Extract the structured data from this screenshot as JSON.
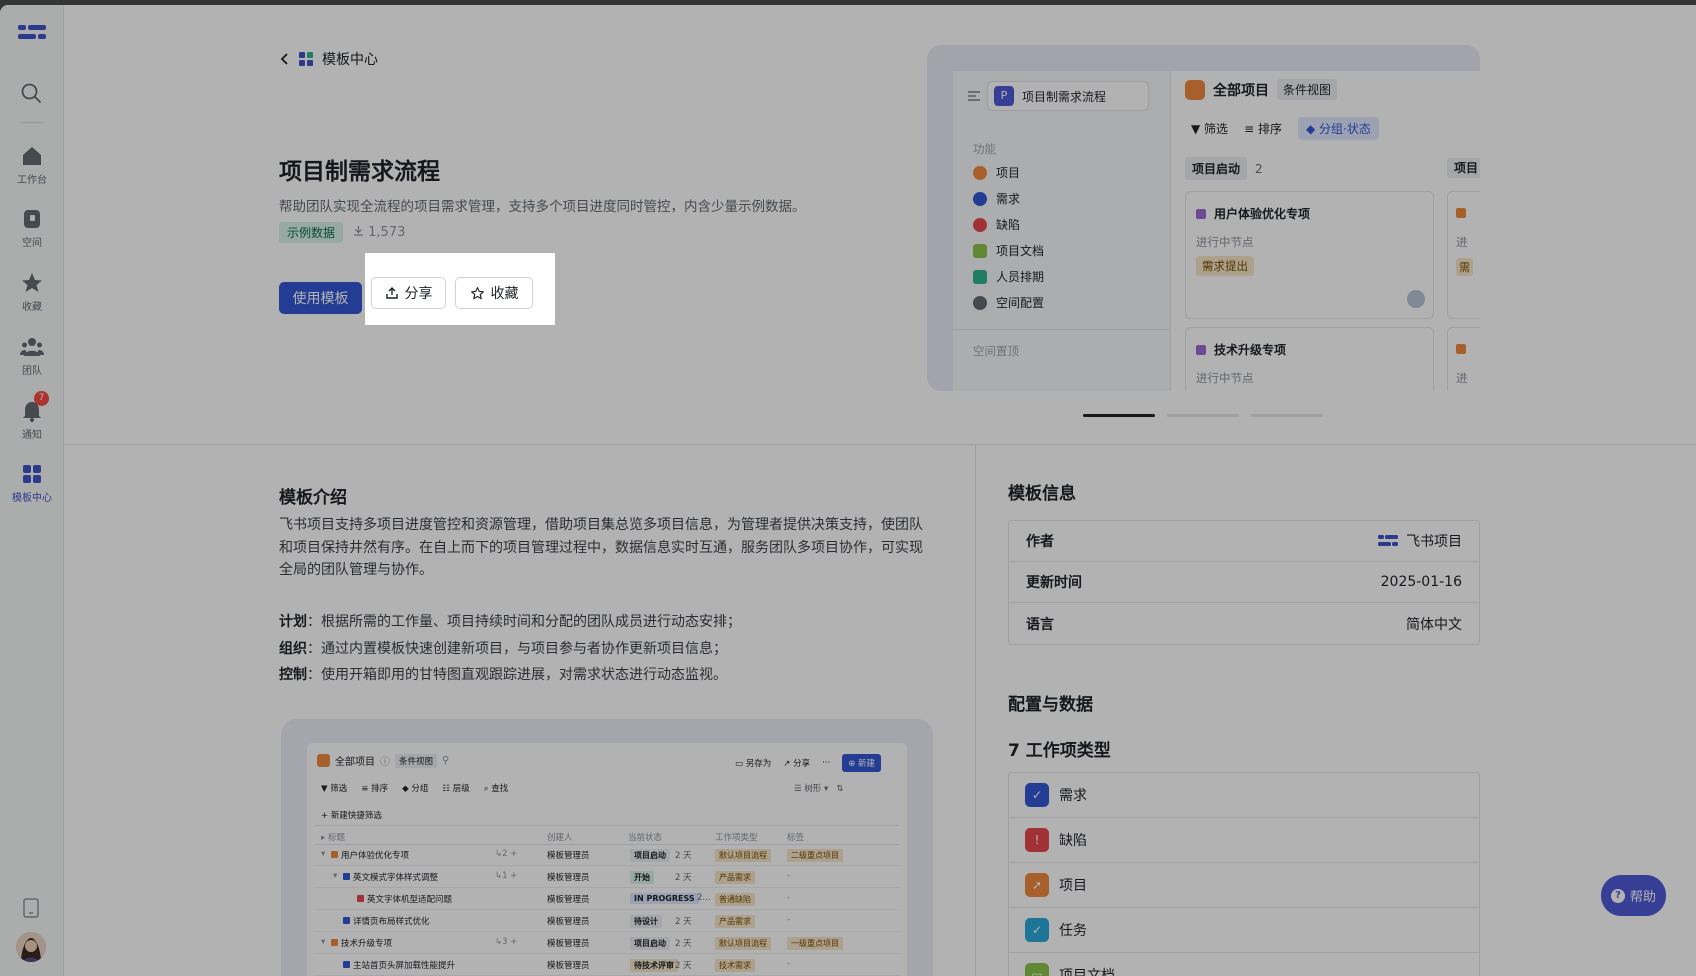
{
  "header": {
    "back_label": "模板中心"
  },
  "template": {
    "title": "项目制需求流程",
    "subtitle": "帮助团队实现全流程的项目需求管理，支持多个项目进度同时管控，内含少量示例数据。",
    "tag": "示例数据",
    "downloads": "1,573",
    "use_button": "使用模板",
    "share_button": "分享",
    "favorite_button": "收藏"
  },
  "sidebar": {
    "items": [
      {
        "label": "工作台",
        "icon": "home-icon"
      },
      {
        "label": "空间",
        "icon": "space-icon"
      },
      {
        "label": "收藏",
        "icon": "star-icon"
      },
      {
        "label": "团队",
        "icon": "team-icon"
      },
      {
        "label": "通知",
        "icon": "bell-icon",
        "badge": "7"
      },
      {
        "label": "模板中心",
        "icon": "template-icon",
        "active": true
      }
    ]
  },
  "preview": {
    "project_name": "项目制需求流程",
    "project_initial": "P",
    "section_label": "功能",
    "nav": [
      {
        "label": "项目",
        "color": "#f08a3e"
      },
      {
        "label": "需求",
        "color": "#3358d4"
      },
      {
        "label": "缺陷",
        "color": "#e5484d"
      },
      {
        "label": "项目文档",
        "color": "#8cc34a"
      },
      {
        "label": "人员排期",
        "color": "#2fb48f"
      },
      {
        "label": "空间配置",
        "color": "#646a73"
      }
    ],
    "section2_label": "空间置顶",
    "view_title": "全部项目",
    "view_type": "条件视图",
    "tools": [
      "筛选",
      "排序",
      "分组·状态"
    ],
    "column_title": "项目启动",
    "column_count": "2",
    "column2_title": "项目",
    "cards": [
      {
        "title": "用户体验优化专项",
        "node_label": "进行中节点",
        "node": "需求提出"
      },
      {
        "title": "技术升级专项",
        "node_label": "进行中节点"
      }
    ],
    "card_side_texts": [
      "进",
      "需",
      "进"
    ]
  },
  "intro": {
    "title": "模板介绍",
    "body": "飞书项目支持多项目进度管控和资源管理，借助项目集总览多项目信息，为管理者提供决策支持，使团队和项目保持井然有序。在自上而下的项目管理过程中，数据信息实时互通，服务团队多项目协作，可实现全局的团队管理与协作。",
    "points": [
      {
        "key": "计划",
        "text": "：根据所需的工作量、项目持续时间和分配的团队成员进行动态安排；"
      },
      {
        "key": "组织",
        "text": "：通过内置模板快速创建新项目，与项目参与者协作更新项目信息；"
      },
      {
        "key": "控制",
        "text": "：使用开箱即用的甘特图直观跟踪进展，对需求状态进行动态监视。"
      }
    ]
  },
  "screenshot": {
    "view_title": "全部项目",
    "view_type": "条件视图",
    "actions": [
      "另存为",
      "分享",
      "···",
      "新建"
    ],
    "tools": [
      "筛选",
      "排序",
      "分组",
      "层级",
      "查找"
    ],
    "tree_label": "树形",
    "quick_filter": "新建快捷筛选",
    "columns": [
      "标题",
      "创建人",
      "当前状态",
      "工作项类型",
      "标签"
    ],
    "rows": [
      {
        "title": "用户体验优化专项",
        "count": "2",
        "creator": "模板管理员",
        "status": "项目启动",
        "days": "2 天",
        "type": "默认项目流程",
        "tag": "二级重点项目"
      },
      {
        "title": "英文模式字体样式调整",
        "count": "1",
        "creator": "模板管理员",
        "status": "开始",
        "days": "2 天",
        "type": "产品需求",
        "tag": "-"
      },
      {
        "title": "英文字体机型适配问题",
        "count": "",
        "creator": "模板管理员",
        "status": "IN PROGRESS",
        "days": "2...",
        "type": "普通缺陷",
        "tag": "-"
      },
      {
        "title": "详情页布局样式优化",
        "count": "",
        "creator": "模板管理员",
        "status": "待设计",
        "days": "2 天",
        "type": "产品需求",
        "tag": "-"
      },
      {
        "title": "技术升级专项",
        "count": "3",
        "creator": "模板管理员",
        "status": "项目启动",
        "days": "2 天",
        "type": "默认项目流程",
        "tag": "一级重点项目"
      },
      {
        "title": "主站首页头屏加载性能提升",
        "count": "",
        "creator": "模板管理员",
        "status": "待技术评审",
        "days": "2 天",
        "type": "技术需求",
        "tag": "-"
      }
    ]
  },
  "info": {
    "title": "模板信息",
    "rows": [
      {
        "key": "作者",
        "value": "飞书项目"
      },
      {
        "key": "更新时间",
        "value": "2025-01-16"
      },
      {
        "key": "语言",
        "value": "简体中文"
      }
    ]
  },
  "config": {
    "title": "配置与数据",
    "work_types_title": "7 工作项类型",
    "work_types": [
      {
        "label": "需求",
        "color": "#3358d4",
        "icon": "check-circle-icon"
      },
      {
        "label": "缺陷",
        "color": "#e5484d",
        "icon": "alert-icon"
      },
      {
        "label": "项目",
        "color": "#f08a3e",
        "icon": "rocket-icon"
      },
      {
        "label": "任务",
        "color": "#2aa8d8",
        "icon": "check-circle-icon"
      },
      {
        "label": "项目文档",
        "color": "#8cc34a",
        "icon": "doc-icon"
      }
    ]
  },
  "help": {
    "label": "帮助"
  }
}
